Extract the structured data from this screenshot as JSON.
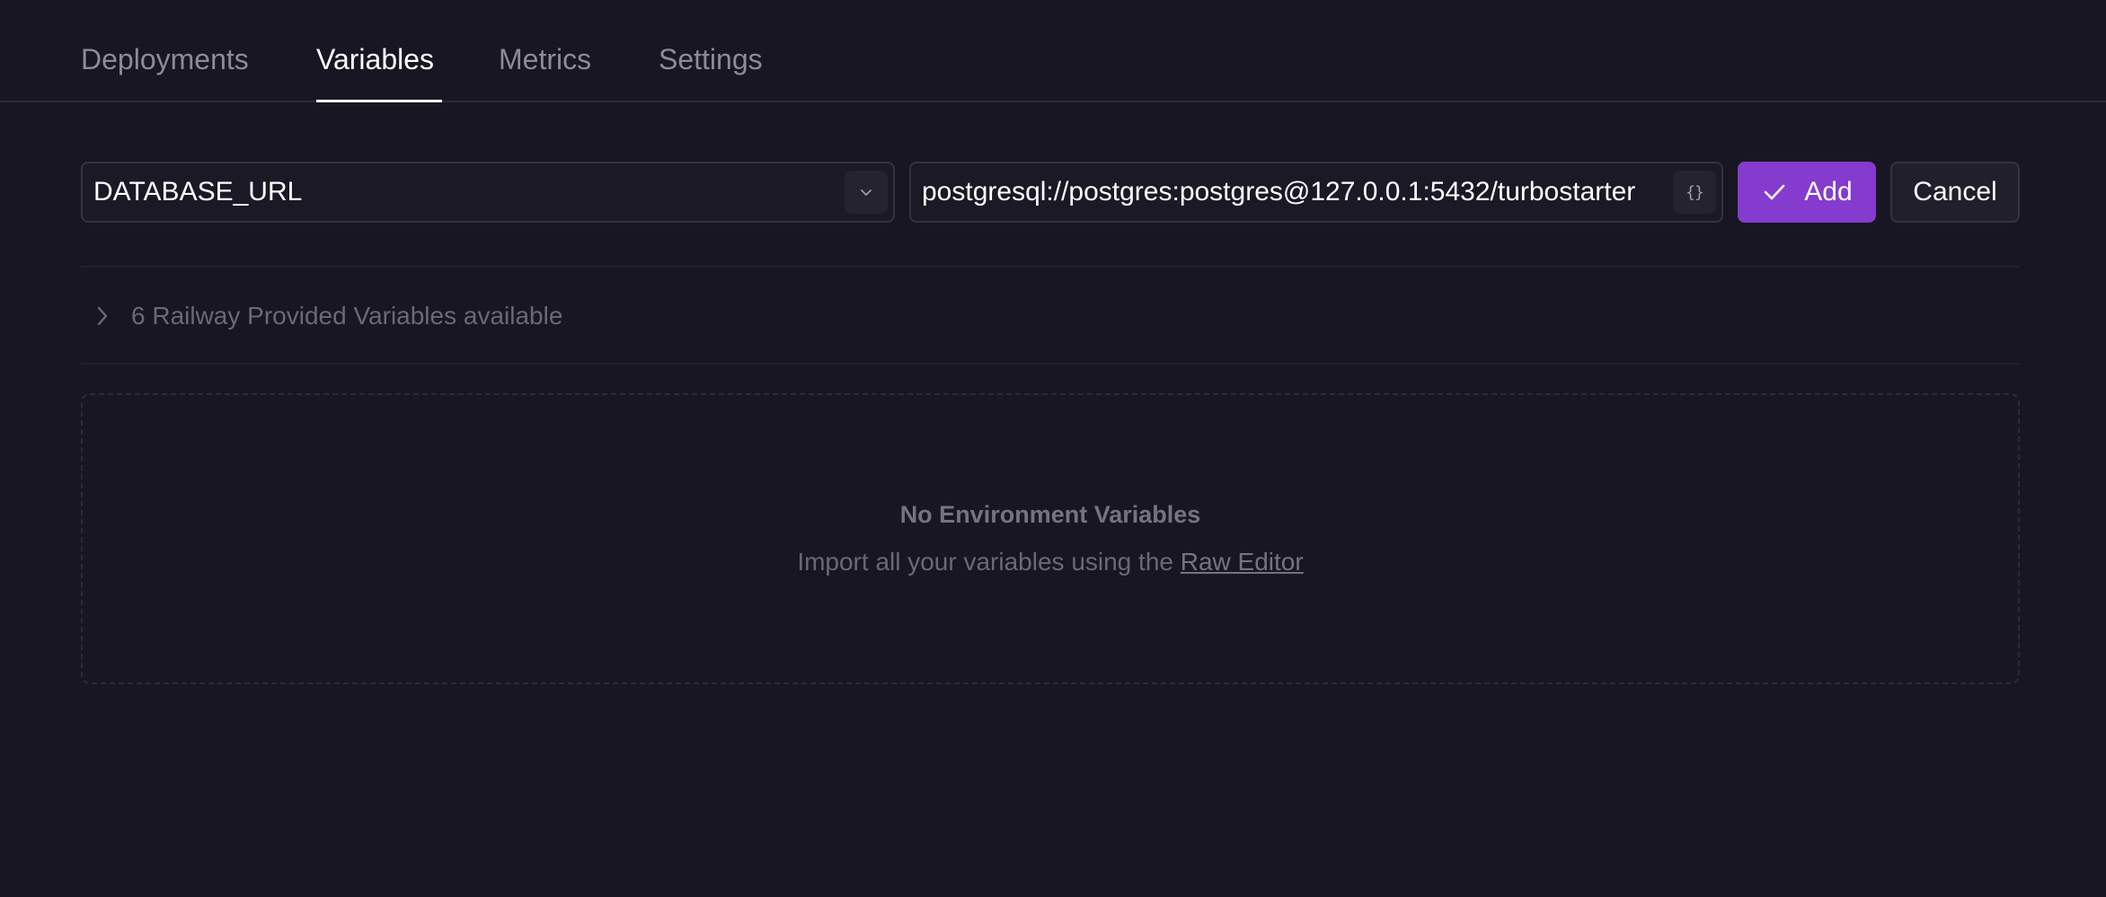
{
  "tabs": [
    {
      "label": "Deployments",
      "active": false
    },
    {
      "label": "Variables",
      "active": true
    },
    {
      "label": "Metrics",
      "active": false
    },
    {
      "label": "Settings",
      "active": false
    }
  ],
  "form": {
    "name_value": "DATABASE_URL",
    "value_value": "postgresql://postgres:postgres@127.0.0.1:5432/turbostarter",
    "value_button_glyph": "{}",
    "add_label": "Add",
    "cancel_label": "Cancel"
  },
  "provided": {
    "label": "6 Railway Provided Variables available"
  },
  "empty_state": {
    "title": "No Environment Variables",
    "subtitle_prefix": "Import all your variables using the ",
    "link_label": "Raw Editor"
  },
  "colors": {
    "background": "#181622",
    "accent": "#853bce",
    "border": "#35323f"
  }
}
